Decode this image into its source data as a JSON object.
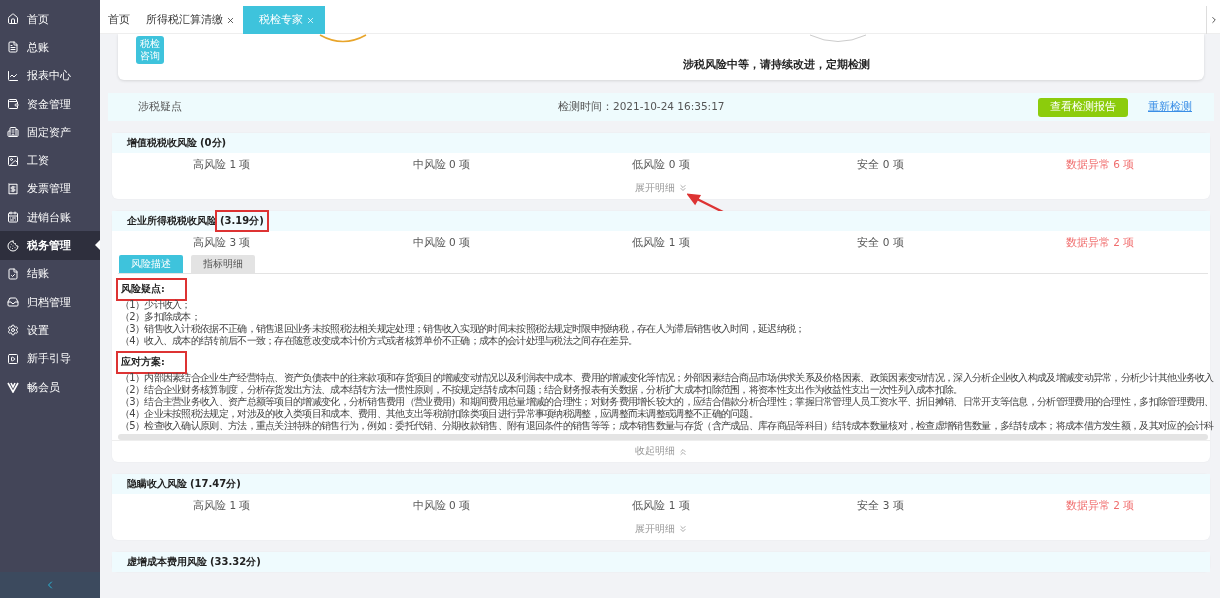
{
  "sidebar": {
    "items": [
      {
        "label": "首页",
        "selected": false
      },
      {
        "label": "总账",
        "selected": false
      },
      {
        "label": "报表中心",
        "selected": false
      },
      {
        "label": "资金管理",
        "selected": false
      },
      {
        "label": "固定资产",
        "selected": false
      },
      {
        "label": "工资",
        "selected": false
      },
      {
        "label": "发票管理",
        "selected": false
      },
      {
        "label": "进销台账",
        "selected": false
      },
      {
        "label": "税务管理",
        "selected": true
      },
      {
        "label": "结账",
        "selected": false
      },
      {
        "label": "归档管理",
        "selected": false
      },
      {
        "label": "设置",
        "selected": false
      },
      {
        "label": "新手引导",
        "selected": false
      },
      {
        "label": "畅会员",
        "selected": false
      }
    ]
  },
  "tabs": [
    {
      "label": "首页",
      "selected": false,
      "closable": false
    },
    {
      "label": "所得税汇算清缴",
      "selected": false,
      "closable": true
    },
    {
      "label": "税检专家",
      "selected": true,
      "closable": true
    }
  ],
  "summary": {
    "badge": "税检咨询",
    "message": "涉税风险中等，请持续改进，定期检测"
  },
  "check_bar": {
    "label": "涉税疑点",
    "time": "检测时间：2021-10-24 16:35:17",
    "report_button": "查看检测报告",
    "recheck_link": "重新检测"
  },
  "sections": [
    {
      "title": "增值税税收风险",
      "score": "(0分)",
      "score_highlighted": false,
      "expanded": false,
      "pointed": true,
      "toggle": "展开明细",
      "counts": [
        {
          "text": "高风险 1 项",
          "alert": false
        },
        {
          "text": "中风险 0 项",
          "alert": false
        },
        {
          "text": "低风险 0 项",
          "alert": false
        },
        {
          "text": "安全 0 项",
          "alert": false
        },
        {
          "text": "数据异常 6 项",
          "alert": true
        }
      ]
    },
    {
      "title": "企业所得税税收风险",
      "score": "(3.19分)",
      "score_highlighted": true,
      "expanded": true,
      "pointed": false,
      "toggle": "收起明细",
      "counts": [
        {
          "text": "高风险 3 项",
          "alert": false
        },
        {
          "text": "中风险 0 项",
          "alert": false
        },
        {
          "text": "低风险 1 项",
          "alert": false
        },
        {
          "text": "安全 0 项",
          "alert": false
        },
        {
          "text": "数据异常 2 项",
          "alert": true
        }
      ],
      "detail_tabs": [
        {
          "label": "风险描述",
          "selected": true
        },
        {
          "label": "指标明细",
          "selected": false
        }
      ],
      "blocks": [
        {
          "heading": "风险疑点:",
          "highlighted": true,
          "lines": [
            "（1）少计收入；",
            "（2）多扣除成本；",
            "（3）销售收入计税依据不正确，销售退回业务未按照税法相关规定处理；销售收入实现的时间未按照税法规定时限申报纳税，存在人为滞后销售收入时间，延迟纳税；",
            "（4）收入、成本的结转前后不一致；存在随意改变成本计价方式或者核算单价不正确；成本的会计处理与税法之间存在差异。"
          ]
        },
        {
          "heading": "应对方案:",
          "highlighted": true,
          "lines": [
            "（1）内部因素结合企业生产经营特点、资产负债表中的往来款项和存货项目的增减变动情况以及利润表中成本、费用的增减变化等情况；外部因素结合商品市场供求关系及价格因素、政策因素变动情况，深入分析企业收入构成及增减变动异常，分析少计其他业务收入",
            "（2）结合企业财务核算制度，分析存货发出方法、成本结转方法一惯性原则，不按规定结转成本问题；结合财务报表有关数据，分析扩大成本扣除范围，将资本性支出作为收益性支出一次性列入成本扣除。",
            "（3）结合主营业务收入、资产总额等项目的增减变化，分析销售费用（营业费用）和期间费用总量增减的合理性；对财务费用增长较大的，应结合借款分析合理性；掌握日常管理人员工资水平、折旧摊销、日常开支等信息，分析管理费用的合理性，多扣除管理费用、",
            "（4）企业未按照税法规定，对涉及的收入类项目和成本、费用、其他支出等税前扣除类项目进行异常事项纳税调整，应调整而未调整或调整不正确的问题。",
            "（5）检查收入确认原则、方法，重点关注特殊的销售行为，例如：委托代销、分期收款销售、附有退回条件的销售等等；成本销售数量与存货（含产成品、库存商品等科目）结转成本数量核对，检查虚增销售数量，多结转成本；将成本借方发生额，及其对应的会计科"
          ]
        }
      ]
    },
    {
      "title": "隐瞒收入风险",
      "score": "(17.47分)",
      "score_highlighted": false,
      "expanded": false,
      "pointed": false,
      "toggle": "展开明细",
      "counts": [
        {
          "text": "高风险 1 项",
          "alert": false
        },
        {
          "text": "中风险 0 项",
          "alert": false
        },
        {
          "text": "低风险 1 项",
          "alert": false
        },
        {
          "text": "安全 3 项",
          "alert": false
        },
        {
          "text": "数据异常 2 项",
          "alert": true
        }
      ]
    },
    {
      "title": "虚增成本费用风险",
      "score": "(33.32分)",
      "score_highlighted": false
    }
  ]
}
